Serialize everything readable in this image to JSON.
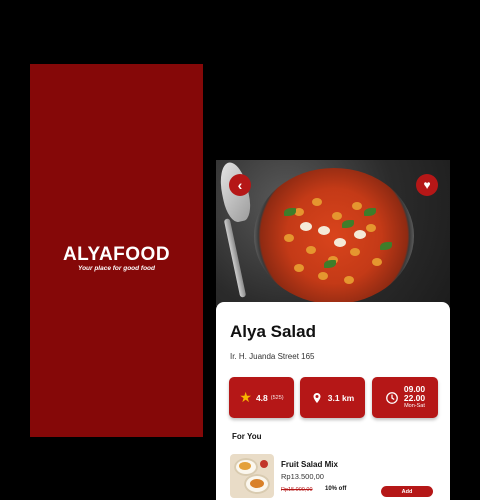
{
  "splash": {
    "brand": "ALYAFOOD",
    "tagline": "Your place for good food",
    "background": "#850808"
  },
  "detail": {
    "back_icon": "chevron-left-icon",
    "favorite_icon": "heart-icon",
    "restaurant_name": "Alya Salad",
    "address": "Ir. H. Juanda Street 165",
    "rating": {
      "value": "4.8",
      "reviews": "(525)",
      "icon": "star-icon"
    },
    "distance": {
      "value": "3.1 km",
      "icon": "location-pin-icon"
    },
    "hours": {
      "open": "09.00",
      "close": "22.00",
      "days": "Mon-Sat",
      "icon": "clock-icon"
    },
    "section_title": "For You",
    "items": [
      {
        "name": "Fruit Salad Mix",
        "price": "Rp13.500,00",
        "old_price": "Rp15.000,00",
        "discount": "10% off",
        "add_label": "Add"
      }
    ],
    "accent": "#b51717"
  }
}
